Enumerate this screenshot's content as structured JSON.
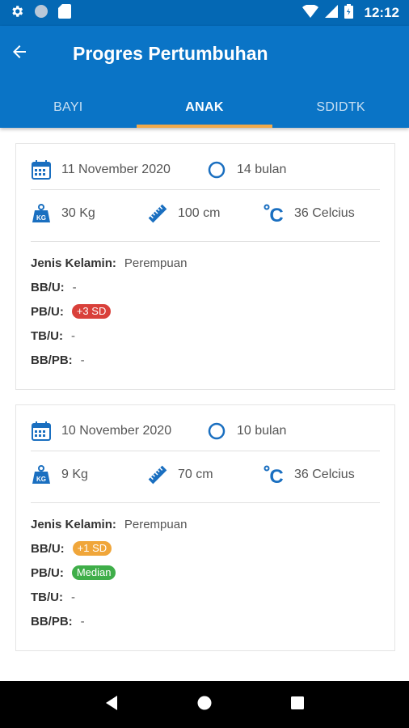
{
  "status_bar": {
    "time": "12:12"
  },
  "app_bar": {
    "title": "Progres Pertumbuhan"
  },
  "tabs": [
    {
      "label": "BAYI",
      "active": false
    },
    {
      "label": "ANAK",
      "active": true
    },
    {
      "label": "SDIDTK",
      "active": false
    }
  ],
  "colors": {
    "primary": "#0a74c6",
    "indicator": "#f0a94a",
    "icon": "#1a6fc0",
    "red": "#d9403a",
    "orange": "#f0a63a",
    "green": "#3fae49"
  },
  "records": [
    {
      "date": "11 November 2020",
      "age": "14 bulan",
      "weight": "30 Kg",
      "height": "100 cm",
      "temperature": "36 Celcius",
      "gender_label": "Jenis Kelamin:",
      "gender_value": "Perempuan",
      "bbu_label": "BB/U:",
      "bbu_value": "-",
      "pbu_label": "PB/U:",
      "pbu_badge": "+3 SD",
      "tbu_label": "TB/U:",
      "tbu_value": "-",
      "bbpb_label": "BB/PB:",
      "bbpb_value": "-"
    },
    {
      "date": "10 November 2020",
      "age": "10 bulan",
      "weight": "9 Kg",
      "height": "70 cm",
      "temperature": "36 Celcius",
      "gender_label": "Jenis Kelamin:",
      "gender_value": "Perempuan",
      "bbu_label": "BB/U:",
      "bbu_badge": "+1 SD",
      "pbu_label": "PB/U:",
      "pbu_badge": "Median",
      "tbu_label": "TB/U:",
      "tbu_value": "-",
      "bbpb_label": "BB/PB:",
      "bbpb_value": "-"
    }
  ]
}
